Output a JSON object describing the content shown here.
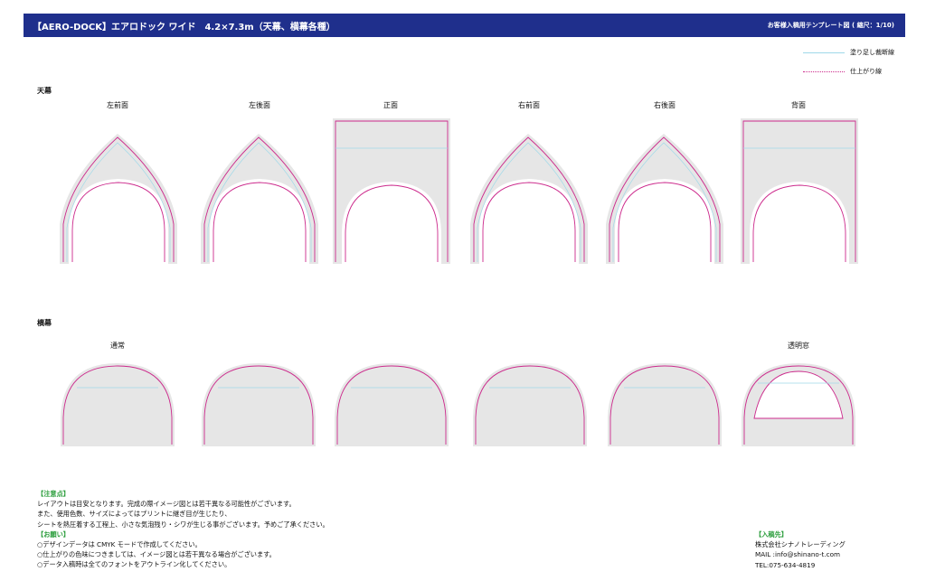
{
  "header": {
    "title": "【AERO-DOCK】エアロドック ワイド　4.2×7.3m（天幕、横幕各種）",
    "subtitle": "お客様入稿用テンプレート図 ( 縮尺：1/10)"
  },
  "legend": {
    "bleed_label": "塗り足し裁断線",
    "finish_label": "仕上がり線",
    "bleed_color": "#9fd9e9",
    "finish_color": "#cc2a8c",
    "panel_fill": "#e6e6e6"
  },
  "roof": {
    "section_label": "天幕",
    "panels": [
      {
        "label": "左前面",
        "shape": "pointed"
      },
      {
        "label": "左後面",
        "shape": "pointed"
      },
      {
        "label": "正面",
        "shape": "rect-arch"
      },
      {
        "label": "右前面",
        "shape": "pointed"
      },
      {
        "label": "右後面",
        "shape": "pointed"
      },
      {
        "label": "背面",
        "shape": "rect-arch"
      }
    ]
  },
  "side": {
    "section_label": "横幕",
    "label_normal": "通常",
    "label_window": "透明窓"
  },
  "notes": {
    "caution_heading": "【注意点】",
    "caution_lines": [
      "レイアウトは目安となります。完成の際イメージ図とは若干異なる可能性がございます。",
      "また、使用色数、サイズによってはプリントに継ぎ目が生じたり、",
      "シートを熱圧着する工程上、小さな気泡残り・シワが生じる事がございます。予めご了承ください。"
    ],
    "request_heading": "【お願い】",
    "request_lines": [
      "○デザインデータは CMYK モードで作成してください。",
      "○仕上がりの色味につきましては、イメージ図とは若干異なる場合がございます。",
      "○データ入稿時は全てのフォントをアウトライン化してください。"
    ]
  },
  "contact": {
    "heading": "【入稿先】",
    "company": "株式会社シナノトレーディング",
    "mail": "MAIL :info@shinano-t.com",
    "tel": "TEL:075-634-4819"
  }
}
